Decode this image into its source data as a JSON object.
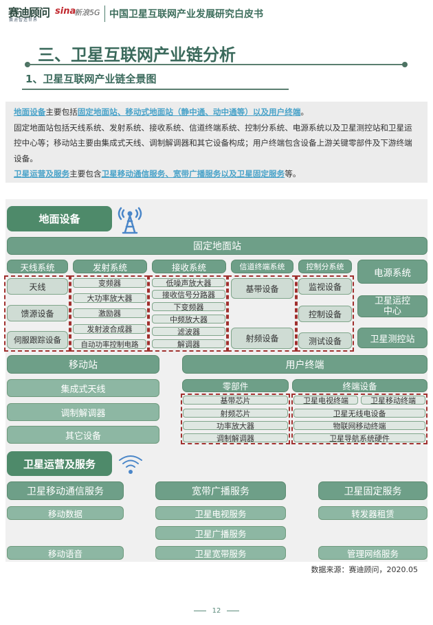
{
  "header": {
    "logo": "赛迪顾问",
    "logo_sub": "赛迪智造世界",
    "sina": "sina",
    "sina_sub": "新浪5G",
    "title": "中国卫星互联网产业发展研究白皮书"
  },
  "section_title": "三、卫星互联网产业链分析",
  "subsection_title": "1、卫星互联网产业链全景图",
  "intro": {
    "p1_link1": "地面设备",
    "p1_text1": "主要包括",
    "p1_link2": "固定地面站、移动式地面站（静中通、动中通等）以及用户终端",
    "p1_end": "。",
    "p2": "固定地面站包括天线系统、发射系统、接收系统、信道终端系统、控制分系统、电源系统以及卫星测控站和卫星运控中心等；移动站主要由集成式天线、调制解调器和其它设备构成；用户终端包含设备上游关键零部件及下游终端设备。",
    "p3_link1": "卫星运营及服务",
    "p3_text1": "主要包含",
    "p3_link2": "卫星移动通信服务、宽带广播服务以及卫星固定服务",
    "p3_end": "等。"
  },
  "diagram": {
    "ground": {
      "title": "地面设备",
      "icon": "antenna-tower-icon",
      "fixed_station": "固定地面站",
      "systems": {
        "antenna": {
          "label": "天线系统",
          "items": [
            "天线",
            "馈源设备",
            "伺服跟踪设备"
          ]
        },
        "transmit": {
          "label": "发射系统",
          "items": [
            "变频器",
            "大功率放大器",
            "激励器",
            "发射波合成器",
            "自动功率控制电路"
          ]
        },
        "receive": {
          "label": "接收系统",
          "items": [
            "低噪声放大器",
            "接收信号分路器",
            "下变频器",
            "中频放大器",
            "滤波器",
            "解调器"
          ]
        },
        "channel": {
          "label": "信道终端系统",
          "items": [
            "基带设备",
            "射频设备"
          ]
        },
        "control": {
          "label": "控制分系统",
          "items": [
            "监视设备",
            "控制设备",
            "测试设备"
          ]
        },
        "power": "电源系统",
        "ops_center": "卫星运控中心",
        "tt_station": "卫星测控站"
      },
      "mobile": {
        "label": "移动站",
        "items": [
          "集成式天线",
          "调制解调器",
          "其它设备"
        ]
      },
      "user_terminal": {
        "label": "用户终端",
        "parts": {
          "label": "零部件",
          "items": [
            "基带芯片",
            "射频芯片",
            "功率放大器",
            "调制解调器"
          ]
        },
        "devices": {
          "label": "终端设备",
          "items": [
            "卫星电视终端",
            "卫星移动终端",
            "卫星无线电设备",
            "物联网移动终端",
            "卫星导航系统硬件"
          ]
        }
      }
    },
    "services": {
      "title": "卫星运营及服务",
      "icon": "wifi-icon",
      "mobile_comm": {
        "label": "卫星移动通信服务",
        "items": [
          "移动数据",
          "移动语音"
        ]
      },
      "broadband": {
        "label": "宽带广播服务",
        "items": [
          "卫星电视服务",
          "卫星广播服务",
          "卫星宽带服务"
        ]
      },
      "fixed": {
        "label": "卫星固定服务",
        "items": [
          "转发器租赁",
          "管理网络服务"
        ]
      }
    }
  },
  "source": "数据来源：赛迪顾问，2020.05",
  "page_number": "12"
}
